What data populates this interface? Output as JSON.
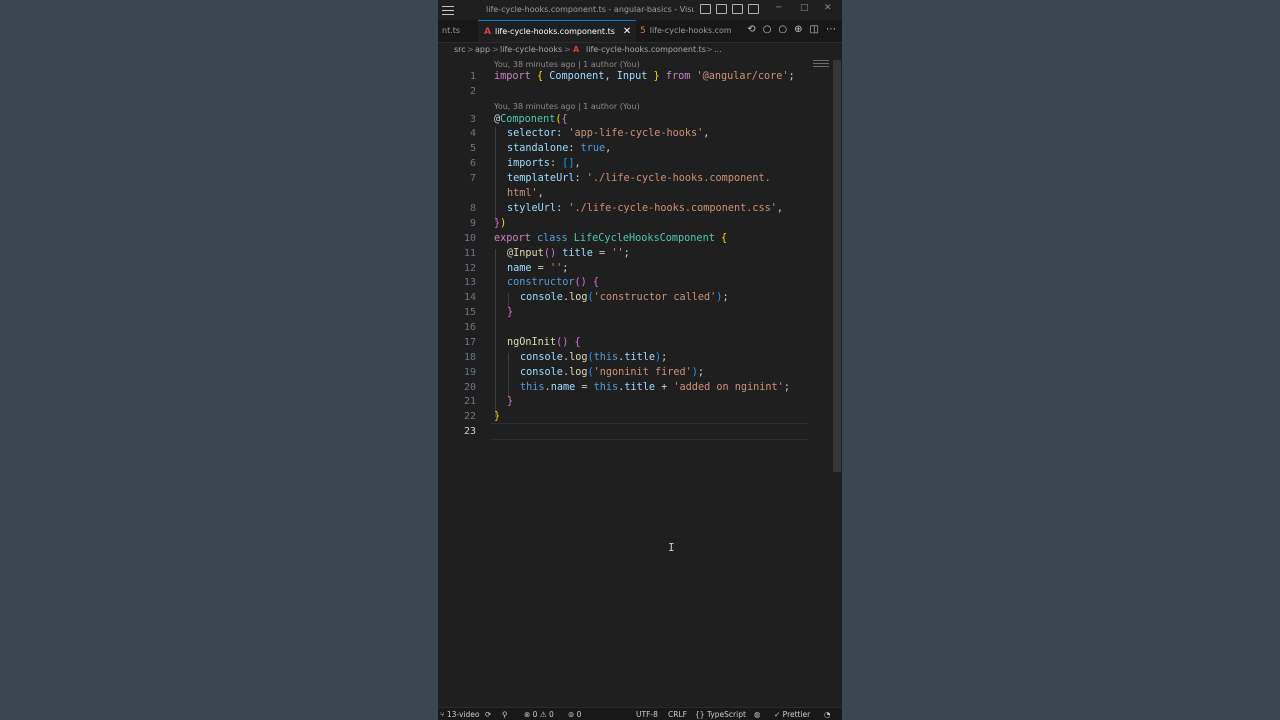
{
  "window": {
    "title": "life-cycle-hooks.component.ts - angular-basics - Visual ...",
    "controls": {
      "minimize": "─",
      "maximize": "□",
      "close": "✕"
    }
  },
  "tabs": [
    {
      "label": "nt.ts",
      "icon": "typescript-icon",
      "active": false
    },
    {
      "label": "life-cycle-hooks.component.ts",
      "icon": "angular-icon",
      "active": true,
      "close": "✕"
    },
    {
      "label": "life-cycle-hooks.com",
      "icon": "html-icon",
      "active": false
    }
  ],
  "tab_actions": [
    "⟲",
    "○",
    "○",
    "⊕",
    "◫",
    "⋯"
  ],
  "breadcrumb": {
    "items": [
      "src",
      "app",
      "life-cycle-hooks",
      "life-cycle-hooks.component.ts",
      "..."
    ],
    "separator": ">"
  },
  "codelens": [
    "You, 38 minutes ago | 1 author (You)",
    "You, 38 minutes ago | 1 author (You)"
  ],
  "line_numbers": [
    "1",
    "2",
    "3",
    "4",
    "5",
    "6",
    "7",
    "",
    "8",
    "9",
    "10",
    "11",
    "12",
    "13",
    "14",
    "15",
    "16",
    "17",
    "18",
    "19",
    "20",
    "21",
    "22",
    "23"
  ],
  "current_line": "23",
  "code": {
    "l1": {
      "import": "import",
      "brace_open": "{",
      "component": "Component",
      "comma": ",",
      "input": "Input",
      "brace_close": "}",
      "from": "from",
      "module": "'@angular/core'",
      "semi": ";"
    },
    "l3": {
      "at": "@",
      "decorator": "Component",
      "paren": "(",
      "brace": "{"
    },
    "l4": {
      "key": "selector",
      "colon": ": ",
      "value": "'app-life-cycle-hooks'",
      "comma": ","
    },
    "l5": {
      "key": "standalone",
      "colon": ": ",
      "value": "true",
      "comma": ","
    },
    "l6": {
      "key": "imports",
      "colon": ": ",
      "value": "[]",
      "comma": ","
    },
    "l7": {
      "key": "templateUrl",
      "colon": ": ",
      "value": "'./life-cycle-hooks.component.",
      "wrap": "html'",
      "comma": ","
    },
    "l8": {
      "key": "styleUrl",
      "colon": ": ",
      "value": "'./life-cycle-hooks.component.css'",
      "comma": ","
    },
    "l9": {
      "brace": "}",
      "paren": ")"
    },
    "l10": {
      "export": "export",
      "class": "class",
      "name": "LifeCycleHooksComponent",
      "brace": "{"
    },
    "l11": {
      "at": "@",
      "decorator": "Input",
      "parens": "()",
      "prop": "title",
      "eq": " = ",
      "value": "''",
      "semi": ";"
    },
    "l12": {
      "prop": "name",
      "eq": " = ",
      "value": "''",
      "semi": ";"
    },
    "l13": {
      "method": "constructor",
      "parens": "()",
      "brace": "{"
    },
    "l14": {
      "obj": "console",
      "dot": ".",
      "fn": "log",
      "open": "(",
      "arg": "'constructor called'",
      "close": ")",
      "semi": ";"
    },
    "l15": {
      "brace": "}"
    },
    "l17": {
      "method": "ngOnInit",
      "parens": "()",
      "brace": "{"
    },
    "l18": {
      "obj": "console",
      "dot": ".",
      "fn": "log",
      "open": "(",
      "this": "this",
      "dot2": ".",
      "prop": "title",
      "close": ")",
      "semi": ";"
    },
    "l19": {
      "obj": "console",
      "dot": ".",
      "fn": "log",
      "open": "(",
      "arg": "'ngoninit fired'",
      "close": ")",
      "semi": ";"
    },
    "l20": {
      "this": "this",
      "dot": ".",
      "prop": "name",
      "eq": " = ",
      "this2": "this",
      "dot2": ".",
      "prop2": "title",
      "plus": " + ",
      "str": "'added on nginint'",
      "semi": ";"
    },
    "l21": {
      "brace": "}"
    },
    "l22": {
      "brace": "}"
    }
  },
  "statusbar": {
    "branch": "13-video",
    "sync_icon": "⟳",
    "errors": "0",
    "warnings": "0",
    "ports": "0",
    "encoding": "UTF-8",
    "eol": "CRLF",
    "language": "TypeScript",
    "formatter": "Prettier"
  },
  "colors": {
    "background": "#3c4652",
    "editor": "#1f1f1f",
    "accent": "#0078d4",
    "angular": "#dd3f3f"
  }
}
